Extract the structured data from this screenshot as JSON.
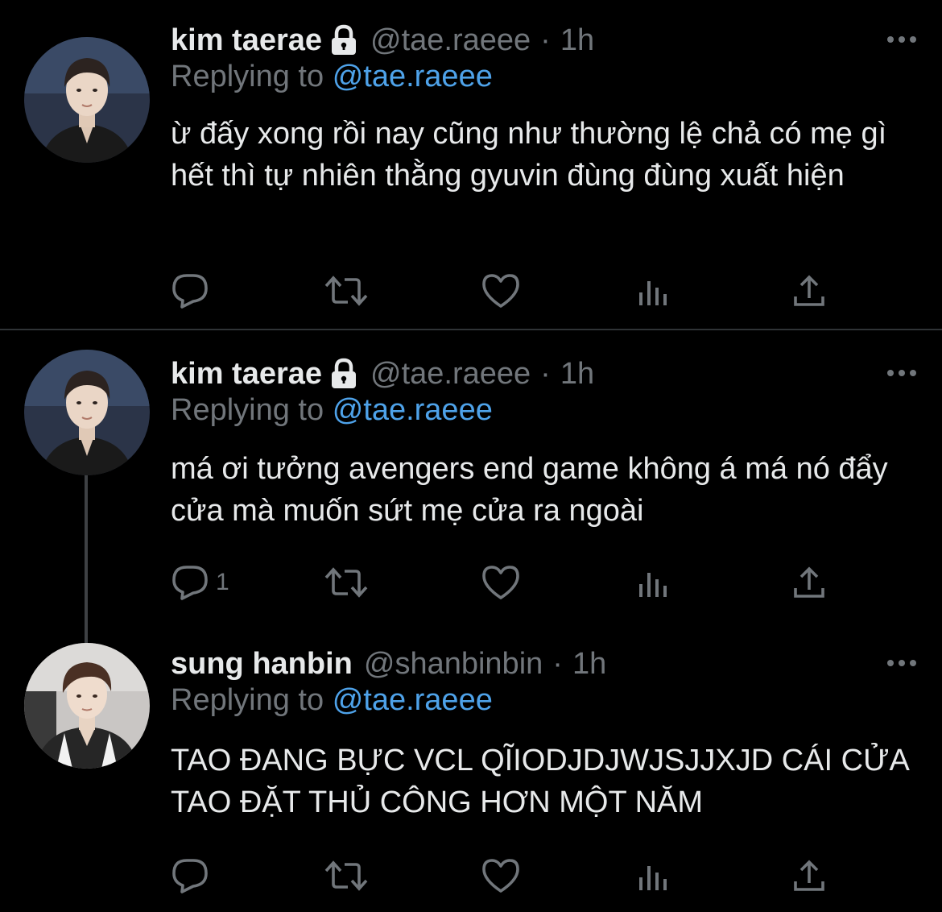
{
  "tweets": [
    {
      "name": "kim taerae",
      "handle": "@tae.raeee",
      "separator": "·",
      "time": "1h",
      "replying_prefix": "Replying to",
      "replying_to": "@tae.raeee",
      "text": "ừ đấy xong rồi nay cũng như thường lệ chả có mẹ gì hết thì tự nhiên thằng gyuvin đùng đùng xuất hiện",
      "reply_count": "",
      "locked": true
    },
    {
      "name": "kim taerae",
      "handle": "@tae.raeee",
      "separator": "·",
      "time": "1h",
      "replying_prefix": "Replying to",
      "replying_to": "@tae.raeee",
      "text": "má ơi tưởng avengers end game không á má nó đẩy cửa mà muốn sứt mẹ cửa ra ngoài",
      "reply_count": "1",
      "locked": true
    },
    {
      "name": "sung hanbin",
      "handle": "@shanbinbin",
      "separator": "·",
      "time": "1h",
      "replying_prefix": "Replying to",
      "replying_to": "@tae.raeee",
      "text": "TAO ĐANG BỰC VCL QĨIODJDJWJSJJXJD CÁI CỬA TAO ĐẶT THỦ CÔNG HƠN MỘT NĂM",
      "reply_count": "",
      "locked": false
    }
  ],
  "icons": {
    "reply": "reply-icon",
    "retweet": "retweet-icon",
    "like": "like-icon",
    "views": "views-icon",
    "share": "share-icon",
    "more": "more-icon",
    "lock": "lock-icon"
  },
  "colors": {
    "background": "#000000",
    "text": "#e7e9ea",
    "secondary": "#71767b",
    "link": "#4ea2e9",
    "divider": "#2f3336"
  }
}
